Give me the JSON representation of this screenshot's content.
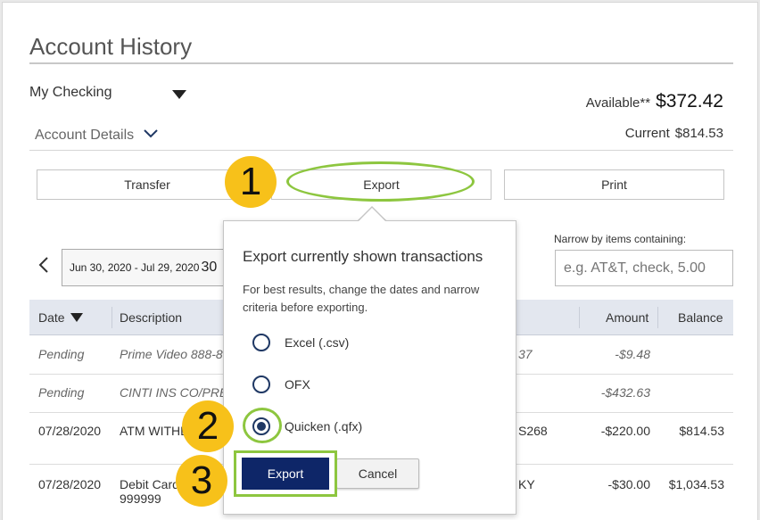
{
  "page": {
    "title": "Account History",
    "account_select": "My Checking",
    "available_label": "Available**",
    "available_value": "$372.42",
    "account_details_label": "Account Details",
    "current_label": "Current",
    "current_value": "$814.53"
  },
  "actions": {
    "transfer": "Transfer",
    "export": "Export",
    "print": "Print"
  },
  "filters": {
    "date_range": "Jun 30, 2020 - Jul 29, 2020",
    "date_range_extra": "30",
    "narrow_label": "Narrow by items containing:",
    "narrow_placeholder": "e.g. AT&T, check, 5.00"
  },
  "table": {
    "headers": {
      "date": "Date",
      "description": "Description",
      "amount": "Amount",
      "balance": "Balance"
    },
    "rows": [
      {
        "date": "Pending",
        "description": "Prime Video 888-80",
        "desc_right": "37",
        "amount": "-$9.48",
        "balance": ""
      },
      {
        "date": "Pending",
        "description": "CINTI INS CO/PRE",
        "desc_right": "",
        "amount": "-$432.63",
        "balance": ""
      },
      {
        "date": "07/28/2020",
        "description": "ATM WITHD",
        "desc_right": "S268",
        "amount": "-$220.00",
        "balance": "$814.53"
      },
      {
        "date": "07/28/2020",
        "description": "Debit Card",
        "description_line2": "999999",
        "desc_right": "KY",
        "amount": "-$30.00",
        "balance": "$1,034.53"
      }
    ]
  },
  "popover": {
    "title": "Export currently shown transactions",
    "hint": "For best results, change the dates and narrow criteria before exporting.",
    "options": [
      {
        "label": "Excel (.csv)",
        "selected": false
      },
      {
        "label": "OFX",
        "selected": false
      },
      {
        "label": "Quicken (.qfx)",
        "selected": true
      }
    ],
    "export_button": "Export",
    "cancel_button": "Cancel"
  },
  "callouts": {
    "step1": "1",
    "step2": "2",
    "step3": "3"
  },
  "colors": {
    "accent_navy": "#0e2668",
    "highlight_green": "#8dc63f",
    "badge_yellow": "#f7c11a"
  }
}
